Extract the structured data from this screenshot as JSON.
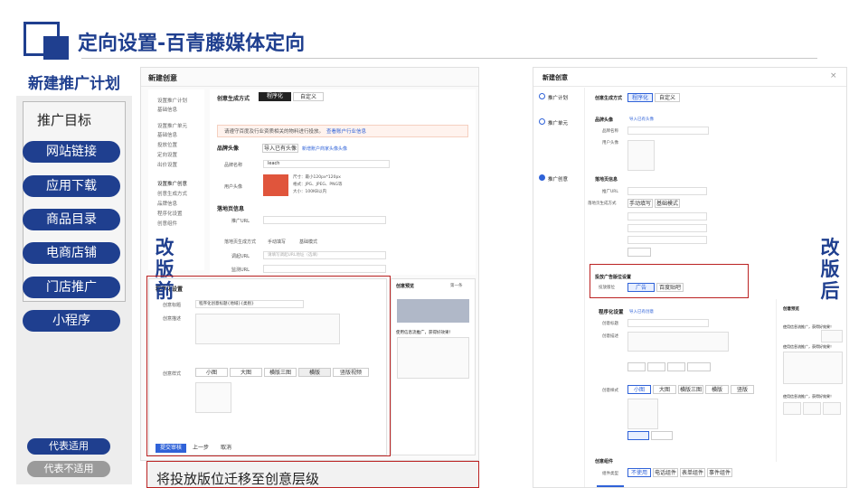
{
  "header": {
    "title": "定向设置-百青藤媒体定向"
  },
  "left": {
    "section_title": "新建推广计划",
    "goal_title": "推广目标",
    "goals": [
      "网站链接",
      "应用下载",
      "商品目录",
      "电商店铺",
      "门店推广",
      "小程序"
    ],
    "legend_applicable": "代表适用",
    "legend_not_applicable": "代表不适用"
  },
  "labels": {
    "before": "改版前",
    "after": "改版后"
  },
  "bottom_note": "将投放版位迁移至创意层级",
  "colors": {
    "brand": "#1f3f8f",
    "highlight": "#b22222",
    "primary_button": "#2f62d8"
  },
  "before_shot": {
    "title": "新建创意",
    "sidebar": [
      "设置推广计划",
      "基础信息",
      "设置推广单元",
      "基础信息",
      "投放位置",
      "定向设置",
      "出价设置",
      "设置推广创意",
      "创意生成方式",
      "品牌信息",
      "程序化设置",
      "创意组件"
    ],
    "creative_mode_label": "创意生成方式",
    "mode_options": [
      "程序化",
      "自定义"
    ],
    "notice": "请遵守百度及行业资质相关的物料进行投放。",
    "notice_link": "查看账户行业信息",
    "brand_section": "品牌头像",
    "brand_btn": "导入已有头像",
    "brand_link": "新增账户商家头像头像",
    "brand_name_label": "品牌名称",
    "brand_name_value": "leach",
    "user_avatar_label": "用户头像",
    "avatar_hint": [
      "尺寸：最小120px*120px",
      "格式：JPG、JPEG、PNG等",
      "大小：100KB以内"
    ],
    "landing_section": "落地页信息",
    "landing_url_label": "推广URL",
    "landing_mode_label": "落地页生成方式",
    "landing_mode_options": [
      "手动填写",
      "基础模式"
    ],
    "deeplink_label": "调起URL",
    "deeplink_placeholder": "请填写调起URL地址（选填）",
    "monitor_label": "监测URL",
    "footer_sidebar": [
      "程序化设置"
    ],
    "ad_title_label": "创意标题",
    "ad_title_value": "程序化创意标题{地域}{类别}",
    "ad_desc_label": "创意描述",
    "ad_size_label": "创意样式",
    "size_options": [
      "小图",
      "大图",
      "横版三图",
      "横版",
      "竖版视频"
    ],
    "submit": "提交审核",
    "prev": "上一步",
    "cancel": "取消",
    "preview_title": "创意预览",
    "preview_right": "第一条",
    "preview_caption": "使用信息流推广，获得好效果！"
  },
  "after_shot": {
    "title": "新建创意",
    "close": "×",
    "steps": [
      "推广计划",
      "推广单元",
      "推广创意"
    ],
    "creative_mode_label": "创意生成方式",
    "mode_options": [
      "程序化",
      "自定义"
    ],
    "brand_section": "品牌头像",
    "brand_link": "导入已有头像",
    "brand_name_label": "品牌名称",
    "user_avatar_label": "用户头像",
    "landing_section": "落地页信息",
    "landing_url_label": "推广URL",
    "landing_mode_label": "落地页生成方式",
    "landing_mode_options": [
      "手动填写",
      "基础模式"
    ],
    "placement_section": "投放广告版位设置",
    "placement_label": "投放版位",
    "placement_options": [
      "广告",
      "百度贴吧"
    ],
    "program_section": "程序化设置",
    "program_link": "导入已有创意",
    "ad_title_label": "创意标题",
    "ad_desc_label": "创意描述",
    "ad_size_label": "创意样式",
    "size_options": [
      "小图",
      "大图",
      "横版三图",
      "横版",
      "竖版"
    ],
    "preview_title": "创意预览",
    "preview_caption_1": "使用信息流推广，获得好效果！",
    "preview_caption_2": "使用信息流推广，获得好效果！",
    "preview_caption_3": "使用信息流推广，获得好效果！",
    "bottom_section": "创意组件",
    "bottom_label": "组件类型",
    "bottom_options": [
      "不使用",
      "电话组件",
      "表单组件",
      "事件组件"
    ]
  }
}
